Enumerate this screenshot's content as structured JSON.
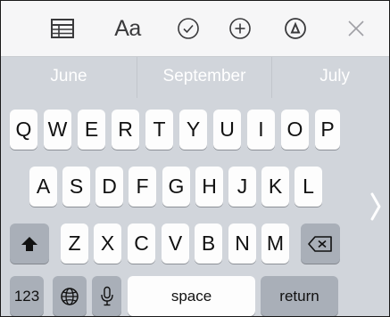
{
  "toolbar": {
    "table_icon": "table-icon",
    "text_format_label": "Aa",
    "checklist_icon": "checkmark-circle-icon",
    "add_icon": "plus-circle-icon",
    "markup_icon": "pen-tip-circle-icon",
    "close_icon": "close-icon"
  },
  "predictive": {
    "suggestions": [
      "June",
      "September",
      "July"
    ]
  },
  "keyboard": {
    "row1": [
      "Q",
      "W",
      "E",
      "R",
      "T",
      "Y",
      "U",
      "I",
      "O",
      "P"
    ],
    "row2": [
      "A",
      "S",
      "D",
      "F",
      "G",
      "H",
      "J",
      "K",
      "L"
    ],
    "row3": [
      "Z",
      "X",
      "C",
      "V",
      "B",
      "N",
      "M"
    ],
    "numbers_label": "123",
    "space_label": "space",
    "return_label": "return"
  },
  "colors": {
    "keyboard_bg": "#d1d5db",
    "key_bg": "#fdfdfd",
    "special_key_bg": "#a9afb8",
    "toolbar_bg": "#f6f6f7"
  }
}
